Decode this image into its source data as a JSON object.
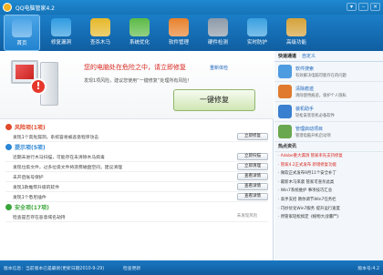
{
  "window": {
    "title": "QQ电脑管家4.2",
    "buttons": [
      "▾",
      "–",
      "×"
    ]
  },
  "toolbar": {
    "items": [
      {
        "label": "首页",
        "icon": "home-icon",
        "color": "#4fa6e8"
      },
      {
        "label": "修复漏洞",
        "icon": "shield-icon",
        "color": "#2f9be0"
      },
      {
        "label": "查杀木马",
        "icon": "scan-icon",
        "color": "#e5b82a"
      },
      {
        "label": "系统优化",
        "icon": "speed-icon",
        "color": "#5cba47"
      },
      {
        "label": "软件管理",
        "icon": "software-icon",
        "color": "#e8822e"
      },
      {
        "label": "硬件检测",
        "icon": "hardware-icon",
        "color": "#8d9aa8"
      },
      {
        "label": "实时防护",
        "icon": "protect-icon",
        "color": "#3aa0e0"
      },
      {
        "label": "高级功能",
        "icon": "tools-icon",
        "color": "#d4a23a"
      }
    ]
  },
  "hero": {
    "message": "您的电脑处在危险之中，请立即修复",
    "link": "重新体检",
    "sub": "发现1项风险，建议您使用“一键修复”处理所有风险！",
    "fix_button": "一键修复"
  },
  "sections": [
    {
      "title": "风险项(1项)",
      "color": "#e04a2a",
      "rows": [
        {
          "text": "发现1个高危漏洞，系统容易被恶意程序攻击",
          "action": "立即修复",
          "enabled": true
        }
      ]
    },
    {
      "title": "提示项(5项)",
      "color": "#2a86d6",
      "rows": [
        {
          "text": "近期未进行木马扫描，可能存在未清除木马病毒",
          "action": "立即扫描",
          "enabled": true
        },
        {
          "text": "发现垃圾文件，过多垃圾文件将浪费磁盘空间，建议清理",
          "action": "立即清理",
          "enabled": true
        },
        {
          "text": "未开启账号保护",
          "action": "查看详情",
          "enabled": true
        },
        {
          "text": "发现1款推荐升级的软件",
          "action": "查看详情",
          "enabled": true
        },
        {
          "text": "发现1个悉尼插件",
          "action": "查看详情",
          "enabled": true
        }
      ]
    },
    {
      "title": "安全项(17项)",
      "color": "#3aa53a",
      "rows": [
        {
          "text": "检查是否存在恶意域名劫持",
          "action": "未发现风险",
          "enabled": false
        }
      ]
    }
  ],
  "right": {
    "tabs": {
      "current": "快速通道",
      "other": "自定义"
    },
    "promos": [
      {
        "title": "软件搜索",
        "desc": "有效解决电脑可能存在的问题",
        "icon": "search-icon",
        "color": "#4d9be0"
      },
      {
        "title": "清除痕迹",
        "desc": "清除使用痕迹，保护个人隐私",
        "icon": "clean-icon",
        "color": "#e07a2e"
      },
      {
        "title": "装机助手",
        "desc": "轻松安装装机必备软件",
        "icon": "install-icon",
        "color": "#3a7fd0"
      },
      {
        "title": "管理启动项目",
        "desc": "管理电脑开机启动项",
        "icon": "startup-icon",
        "color": "#6aa84f"
      }
    ],
    "hot_title": "热点资讯",
    "hot": [
      {
        "text": "· Adobe重大漏洞 管家率先支持修复",
        "red": true
      },
      {
        "text": "· 管家4.2正式发布 新增修复功能",
        "red": true
      },
      {
        "text": "· 微软正式发布9月11个安全补丁",
        "red": false
      },
      {
        "text": "· 最新木马来袭 管家可查杀此类",
        "red": false
      },
      {
        "text": "· Win7系统维护 事项技巧汇总",
        "red": false
      },
      {
        "text": "· 高手支招 教你调节Win7任务栏",
        "red": false
      },
      {
        "text": "· 巧妙优化Win7服务 提升运行速度",
        "red": false
      },
      {
        "text": "· 用管家轻松搞定《植物大战僵尸》",
        "red": false
      }
    ]
  },
  "statusbar": {
    "status": "版本信息：当前版本已是最新(更新日期2010-9-29)",
    "update": "检查更新",
    "version": "版本号:4.2"
  }
}
